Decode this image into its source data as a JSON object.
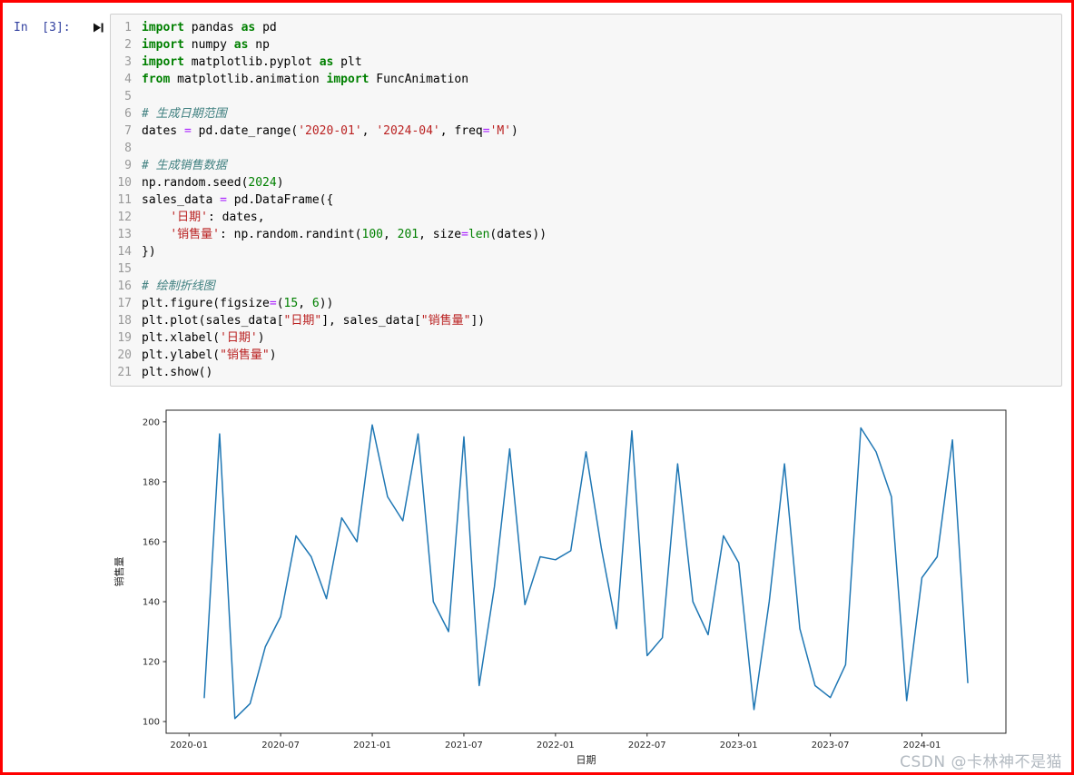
{
  "page": {
    "border_color": "#ff0000",
    "background": "#ffffff"
  },
  "cell": {
    "prompt": "In  [3]:",
    "run_icon": "run-to-end",
    "code_lines": [
      [
        [
          "k",
          "import"
        ],
        [
          "",
          " pandas "
        ],
        [
          "k",
          "as"
        ],
        [
          "",
          " pd"
        ]
      ],
      [
        [
          "k",
          "import"
        ],
        [
          "",
          " numpy "
        ],
        [
          "k",
          "as"
        ],
        [
          "",
          " np"
        ]
      ],
      [
        [
          "k",
          "import"
        ],
        [
          "",
          " matplotlib.pyplot "
        ],
        [
          "k",
          "as"
        ],
        [
          "",
          " plt"
        ]
      ],
      [
        [
          "k",
          "from"
        ],
        [
          "",
          " matplotlib.animation "
        ],
        [
          "k",
          "import"
        ],
        [
          "",
          " FuncAnimation"
        ]
      ],
      [],
      [
        [
          "c",
          "# 生成日期范围"
        ]
      ],
      [
        [
          "",
          "dates "
        ],
        [
          "o",
          "="
        ],
        [
          "",
          " pd.date_range("
        ],
        [
          "s",
          "'2020-01'"
        ],
        [
          "",
          ", "
        ],
        [
          "s",
          "'2024-04'"
        ],
        [
          "",
          ", freq"
        ],
        [
          "o",
          "="
        ],
        [
          "s",
          "'M'"
        ],
        [
          "",
          ")"
        ]
      ],
      [],
      [
        [
          "c",
          "# 生成销售数据"
        ]
      ],
      [
        [
          "",
          "np.random.seed("
        ],
        [
          "n",
          "2024"
        ],
        [
          "",
          ")"
        ]
      ],
      [
        [
          "",
          "sales_data "
        ],
        [
          "o",
          "="
        ],
        [
          "",
          " pd.DataFrame({"
        ]
      ],
      [
        [
          "",
          "    "
        ],
        [
          "s",
          "'日期'"
        ],
        [
          "",
          ": dates,"
        ]
      ],
      [
        [
          "",
          "    "
        ],
        [
          "s",
          "'销售量'"
        ],
        [
          "",
          ": np.random.randint("
        ],
        [
          "n",
          "100"
        ],
        [
          "",
          ", "
        ],
        [
          "n",
          "201"
        ],
        [
          "",
          ", size"
        ],
        [
          "o",
          "="
        ],
        [
          "b",
          "len"
        ],
        [
          "",
          "(dates))"
        ]
      ],
      [
        [
          "",
          "})"
        ]
      ],
      [],
      [
        [
          "c",
          "# 绘制折线图"
        ]
      ],
      [
        [
          "",
          "plt.figure(figsize"
        ],
        [
          "o",
          "="
        ],
        [
          "",
          "("
        ],
        [
          "n",
          "15"
        ],
        [
          "",
          ", "
        ],
        [
          "n",
          "6"
        ],
        [
          "",
          "))"
        ]
      ],
      [
        [
          "",
          "plt.plot(sales_data["
        ],
        [
          "s",
          "\"日期\""
        ],
        [
          "",
          "], sales_data["
        ],
        [
          "s",
          "\"销售量\""
        ],
        [
          "",
          "])"
        ]
      ],
      [
        [
          "",
          "plt.xlabel("
        ],
        [
          "s",
          "'日期'"
        ],
        [
          "",
          ")"
        ]
      ],
      [
        [
          "",
          "plt.ylabel("
        ],
        [
          "s",
          "\"销售量\""
        ],
        [
          "",
          ")"
        ]
      ],
      [
        [
          "",
          "plt.show()"
        ]
      ]
    ]
  },
  "syntax_colors": {
    "keyword": "#008000",
    "string": "#BA2121",
    "comment": "#408080",
    "number": "#008000",
    "operator": "#AA22FF",
    "builtin": "#008000"
  },
  "chart_data": {
    "type": "line",
    "title": "",
    "xlabel": "日期",
    "ylabel": "销售量",
    "x": [
      "2020-01",
      "2020-02",
      "2020-03",
      "2020-04",
      "2020-05",
      "2020-06",
      "2020-07",
      "2020-08",
      "2020-09",
      "2020-10",
      "2020-11",
      "2020-12",
      "2021-01",
      "2021-02",
      "2021-03",
      "2021-04",
      "2021-05",
      "2021-06",
      "2021-07",
      "2021-08",
      "2021-09",
      "2021-10",
      "2021-11",
      "2021-12",
      "2022-01",
      "2022-02",
      "2022-03",
      "2022-04",
      "2022-05",
      "2022-06",
      "2022-07",
      "2022-08",
      "2022-09",
      "2022-10",
      "2022-11",
      "2022-12",
      "2023-01",
      "2023-02",
      "2023-03",
      "2023-04",
      "2023-05",
      "2023-06",
      "2023-07",
      "2023-08",
      "2023-09",
      "2023-10",
      "2023-11",
      "2023-12",
      "2024-01",
      "2024-02",
      "2024-03"
    ],
    "values": [
      108,
      196,
      101,
      106,
      125,
      135,
      162,
      155,
      141,
      168,
      160,
      199,
      175,
      167,
      196,
      140,
      130,
      195,
      112,
      145,
      191,
      139,
      155,
      154,
      157,
      190,
      158,
      131,
      197,
      122,
      128,
      186,
      140,
      129,
      162,
      153,
      104,
      140,
      186,
      131,
      112,
      108,
      119,
      198,
      190,
      175,
      107,
      148,
      155,
      194,
      113
    ],
    "yticks": [
      100,
      120,
      140,
      160,
      180,
      200
    ],
    "xticks": [
      "2020-01",
      "2020-07",
      "2021-01",
      "2021-07",
      "2022-01",
      "2022-07",
      "2023-01",
      "2023-07",
      "2024-01"
    ],
    "xtick_interval_months": 6,
    "xlim": [
      -1.5,
      53.5
    ],
    "ylim": [
      96.1,
      203.9
    ],
    "grid": false,
    "legend": false,
    "line_color": "#1f77b4",
    "axis_color": "#262626"
  },
  "watermark": "CSDN @卡林神不是猫"
}
